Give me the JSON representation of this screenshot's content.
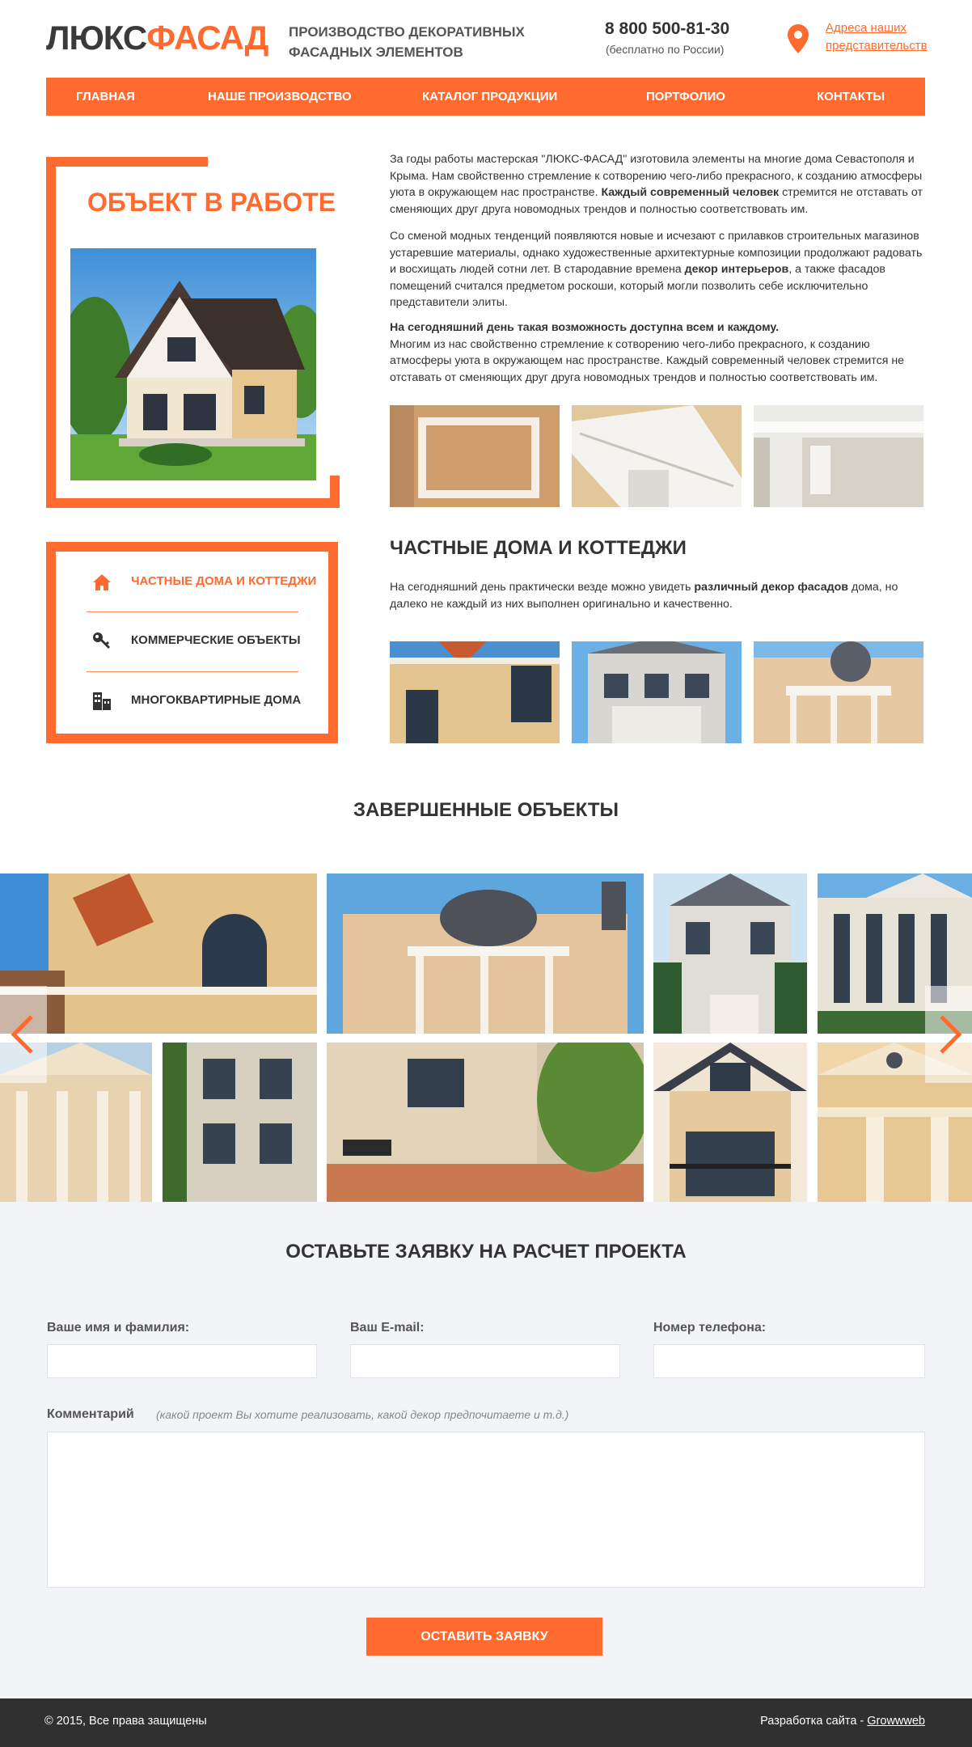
{
  "header": {
    "logo_part1": "ЛЮКС",
    "logo_part2": "ФАСАД",
    "tagline_line1": "ПРОИЗВОДСТВО ДЕКОРАТИВНЫХ",
    "tagline_line2": "ФАСАДНЫХ ЭЛЕМЕНТОВ",
    "phone": "8 800 500-81-30",
    "phone_note": "(бесплатно по России)",
    "address_line1": "Адреса наших",
    "address_line2": "представительств",
    "pin_icon": "map-pin-icon"
  },
  "nav": {
    "items": [
      {
        "label": "ГЛАВНАЯ"
      },
      {
        "label": "НАШЕ ПРОИЗВОДСТВО"
      },
      {
        "label": "КАТАЛОГ ПРОДУКЦИИ"
      },
      {
        "label": "ПОРТФОЛИО"
      },
      {
        "label": "КОНТАКТЫ"
      }
    ]
  },
  "object_in_work": {
    "title": "ОБЪЕКТ В РАБОТЕ"
  },
  "intro": {
    "p1_a": "За годы работы мастерская \"ЛЮКС-ФАСАД\" изготовила элементы на многие дома Севастополя и Крыма. Нам свойственно стремление к сотворению чего-либо прекрасного, к созданию атмосферы уюта в окружающем нас пространстве. ",
    "p1_bold": "Каждый современный человек",
    "p1_b": " стремится не отставать от сменяющих друг друга новомодных трендов и полностью соответствовать им.",
    "p2_a": "Со сменой модных тенденций появляются новые и исчезают с прилавков строительных магазинов устаревшие материалы, однако художественные архитектурные композиции продолжают радовать и восхищать людей сотни лет. В стародавние времена ",
    "p2_bold": "декор интерьеров",
    "p2_b": ", а также фасадов помещений считался предметом роскоши, который могли позволить себе исключительно представители элиты.",
    "p3_bold": "На сегодняшний день такая возможность доступна всем и каждому.",
    "p3_b": "Многим из нас свойственно стремление к сотворению чего-либо прекрасного, к созданию атмосферы уюта в окружающем нас пространстве. Каждый современный человек стремится не отставать от сменяющих друг друга новомодных трендов и полностью соответствовать им."
  },
  "categories": {
    "items": [
      {
        "label": "ЧАСТНЫЕ ДОМА И КОТТЕДЖИ",
        "icon": "home-icon"
      },
      {
        "label": "КОММЕРЧЕСКИЕ ОБЪЕКТЫ",
        "icon": "key-icon"
      },
      {
        "label": "МНОГОКВАРТИРНЫЕ ДОМА",
        "icon": "buildings-icon"
      }
    ]
  },
  "private_houses": {
    "title": "ЧАСТНЫЕ ДОМА И КОТТЕДЖИ",
    "text_a": "На сегодняшний день практически везде можно увидеть ",
    "text_bold": "различный декор фасадов",
    "text_b": " дома, но далеко не каждый из них выполнен оригинально и качественно."
  },
  "completed": {
    "title": "ЗАВЕРШЕННЫЕ ОБЪЕКТЫ",
    "prev_icon": "chevron-left-icon",
    "next_icon": "chevron-right-icon"
  },
  "form": {
    "title": "ОСТАВЬТЕ ЗАЯВКУ НА РАСЧЕТ ПРОЕКТА",
    "name_label": "Ваше имя и фамилия:",
    "email_label": "Ваш E-mail:",
    "phone_label": "Номер телефона:",
    "comment_label": "Комментарий",
    "comment_hint": "(какой проект Вы хотите реализовать, какой декор предпочитаете и т.д.)",
    "submit_label": "ОСТАВИТЬ ЗАЯВКУ"
  },
  "footer": {
    "copyright": "© 2015, Все права защищены",
    "dev_label": "Разработка сайта - ",
    "dev_link": "Growwweb"
  },
  "colors": {
    "accent": "#ff6a2f",
    "dark": "#333333",
    "footer_bg": "#303030",
    "form_bg": "#f3f4f8"
  }
}
